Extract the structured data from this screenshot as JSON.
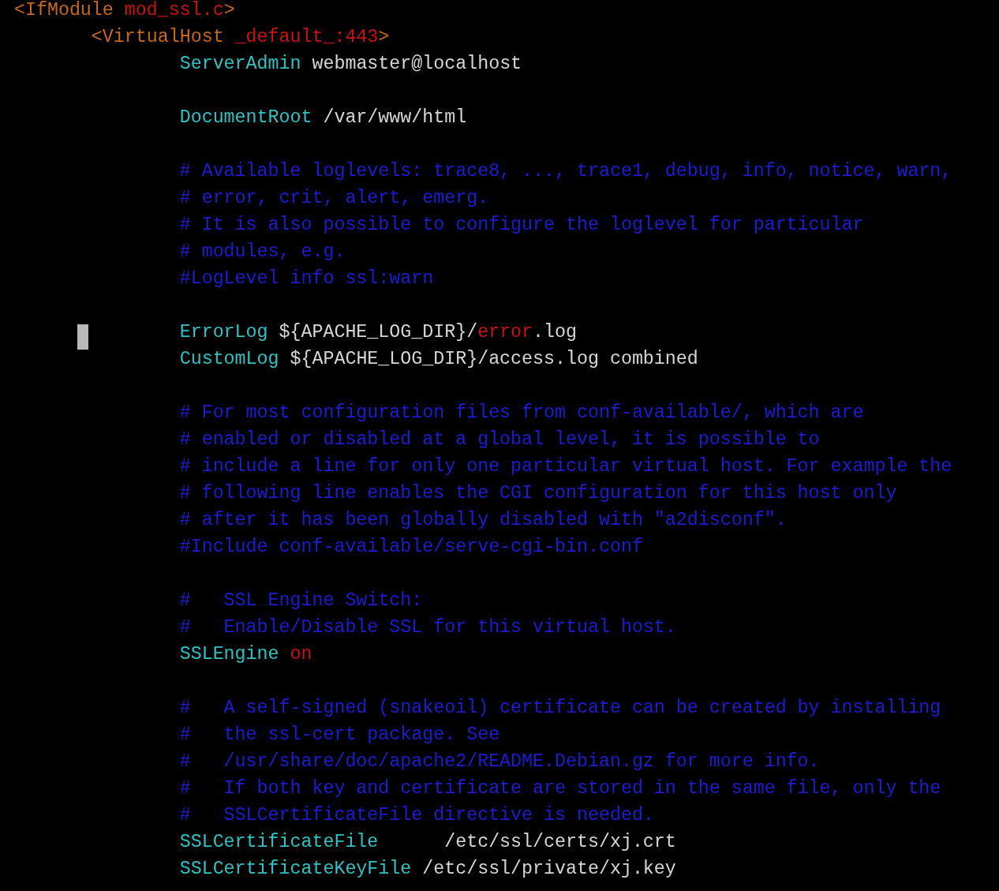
{
  "lines": [
    {
      "kind": "code",
      "segments": [
        {
          "kind": "tag",
          "text": "<IfModule "
        },
        {
          "kind": "arg",
          "text": "mod_ssl.c"
        },
        {
          "kind": "tag",
          "text": ">"
        }
      ]
    },
    {
      "kind": "code",
      "segments": [
        {
          "kind": "tag",
          "text": "\t<VirtualHost "
        },
        {
          "kind": "arg",
          "text": "_default_:443"
        },
        {
          "kind": "tag",
          "text": ">"
        }
      ]
    },
    {
      "kind": "code",
      "segments": [
        {
          "kind": "keyword",
          "text": "\t\tServerAdmin"
        },
        {
          "kind": "plain",
          "text": " webmaster@localhost"
        }
      ]
    },
    {
      "kind": "blank"
    },
    {
      "kind": "code",
      "segments": [
        {
          "kind": "keyword",
          "text": "\t\tDocumentRoot"
        },
        {
          "kind": "plain",
          "text": " /var/www/html"
        }
      ]
    },
    {
      "kind": "blank"
    },
    {
      "kind": "code",
      "segments": [
        {
          "kind": "comment",
          "text": "\t\t# Available loglevels: trace8, ..., trace1, debug, info, notice, warn,"
        }
      ]
    },
    {
      "kind": "code",
      "segments": [
        {
          "kind": "comment",
          "text": "\t\t# error, crit, alert, emerg."
        }
      ]
    },
    {
      "kind": "code",
      "segments": [
        {
          "kind": "comment",
          "text": "\t\t# It is also possible to configure the loglevel for particular"
        }
      ]
    },
    {
      "kind": "code",
      "segments": [
        {
          "kind": "comment",
          "text": "\t\t# modules, e.g."
        }
      ]
    },
    {
      "kind": "code",
      "segments": [
        {
          "kind": "comment",
          "text": "\t\t#LogLevel info ssl:warn"
        }
      ]
    },
    {
      "kind": "blank"
    },
    {
      "kind": "code",
      "cursor": true,
      "segments": [
        {
          "kind": "keyword",
          "text": "\t\tErrorLog"
        },
        {
          "kind": "plain",
          "text": " ${APACHE_LOG_DIR}/"
        },
        {
          "kind": "arg",
          "text": "error"
        },
        {
          "kind": "plain",
          "text": ".log"
        }
      ]
    },
    {
      "kind": "code",
      "segments": [
        {
          "kind": "keyword",
          "text": "\t\tCustomLog"
        },
        {
          "kind": "plain",
          "text": " ${APACHE_LOG_DIR}/access.log combined"
        }
      ]
    },
    {
      "kind": "blank"
    },
    {
      "kind": "code",
      "segments": [
        {
          "kind": "comment",
          "text": "\t\t# For most configuration files from conf-available/, which are"
        }
      ]
    },
    {
      "kind": "code",
      "segments": [
        {
          "kind": "comment",
          "text": "\t\t# enabled or disabled at a global level, it is possible to"
        }
      ]
    },
    {
      "kind": "code",
      "segments": [
        {
          "kind": "comment",
          "text": "\t\t# include a line for only one particular virtual host. For example the"
        }
      ]
    },
    {
      "kind": "code",
      "segments": [
        {
          "kind": "comment",
          "text": "\t\t# following line enables the CGI configuration for this host only"
        }
      ]
    },
    {
      "kind": "code",
      "segments": [
        {
          "kind": "comment",
          "text": "\t\t# after it has been globally disabled with \"a2disconf\"."
        }
      ]
    },
    {
      "kind": "code",
      "segments": [
        {
          "kind": "comment",
          "text": "\t\t#Include conf-available/serve-cgi-bin.conf"
        }
      ]
    },
    {
      "kind": "blank"
    },
    {
      "kind": "code",
      "segments": [
        {
          "kind": "comment",
          "text": "\t\t#   SSL Engine Switch:"
        }
      ]
    },
    {
      "kind": "code",
      "segments": [
        {
          "kind": "comment",
          "text": "\t\t#   Enable/Disable SSL for this virtual host."
        }
      ]
    },
    {
      "kind": "code",
      "segments": [
        {
          "kind": "keyword",
          "text": "\t\tSSLEngine"
        },
        {
          "kind": "arg",
          "text": " on"
        }
      ]
    },
    {
      "kind": "blank"
    },
    {
      "kind": "code",
      "segments": [
        {
          "kind": "comment",
          "text": "\t\t#   A self-signed (snakeoil) certificate can be created by installing"
        }
      ]
    },
    {
      "kind": "code",
      "segments": [
        {
          "kind": "comment",
          "text": "\t\t#   the ssl-cert package. See"
        }
      ]
    },
    {
      "kind": "code",
      "segments": [
        {
          "kind": "comment",
          "text": "\t\t#   /usr/share/doc/apache2/README.Debian.gz for more info."
        }
      ]
    },
    {
      "kind": "code",
      "segments": [
        {
          "kind": "comment",
          "text": "\t\t#   If both key and certificate are stored in the same file, only the"
        }
      ]
    },
    {
      "kind": "code",
      "segments": [
        {
          "kind": "comment",
          "text": "\t\t#   SSLCertificateFile directive is needed."
        }
      ]
    },
    {
      "kind": "code",
      "segments": [
        {
          "kind": "keyword",
          "text": "\t\tSSLCertificateFile"
        },
        {
          "kind": "plain",
          "text": "\t/etc/ssl/certs/xj.crt"
        }
      ]
    },
    {
      "kind": "code",
      "segments": [
        {
          "kind": "keyword",
          "text": "\t\tSSLCertificateKeyFile"
        },
        {
          "kind": "plain",
          "text": " /etc/ssl/private/xj.key"
        }
      ]
    }
  ]
}
